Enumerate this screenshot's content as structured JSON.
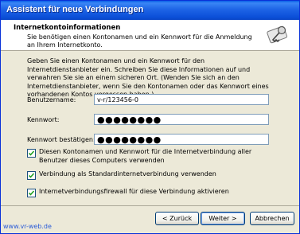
{
  "window": {
    "title": "Assistent für neue Verbindungen"
  },
  "header": {
    "title": "Internetkontoinformationen",
    "subtitle": "Sie benötigen einen Kontonamen und ein Kennwort für die Anmeldung an Ihrem Internetkonto.",
    "icon": "key-card-icon"
  },
  "intro": "Geben Sie einen Kontonamen und ein Kennwort für den Internetdienstanbieter ein. Schreiben Sie diese Informationen auf und verwahren Sie sie an einem sicheren Ort. (Wenden Sie sich an den Internetdienstanbieter, wenn Sie den Kontonamen oder das Kennwort eines vorhandenen Kontos vergessen haben.)",
  "fields": {
    "username": {
      "label": "Benutzername:",
      "value": "v-r/123456-0"
    },
    "password": {
      "label": "Kennwort:",
      "value": "●●●●●●●●"
    },
    "confirm": {
      "label": "Kennwort bestätigen:",
      "value": "●●●●●●●●"
    }
  },
  "checkboxes": [
    {
      "label": "Diesen Kontonamen und Kennwort für die Internetverbindung aller Benutzer dieses Computers verwenden",
      "checked": true
    },
    {
      "label": "Verbindung als Standardinternetverbindung verwenden",
      "checked": true
    },
    {
      "label": "Internetverbindungsfirewall für diese Verbindung aktivieren",
      "checked": true
    }
  ],
  "buttons": {
    "back": "< Zurück",
    "next": "Weiter >",
    "cancel": "Abbrechen"
  },
  "watermark": "www.vr-web.de",
  "colors": {
    "titlebar": "#0a5fe6",
    "checkmark": "#21a121",
    "link": "#2a5bd7"
  }
}
